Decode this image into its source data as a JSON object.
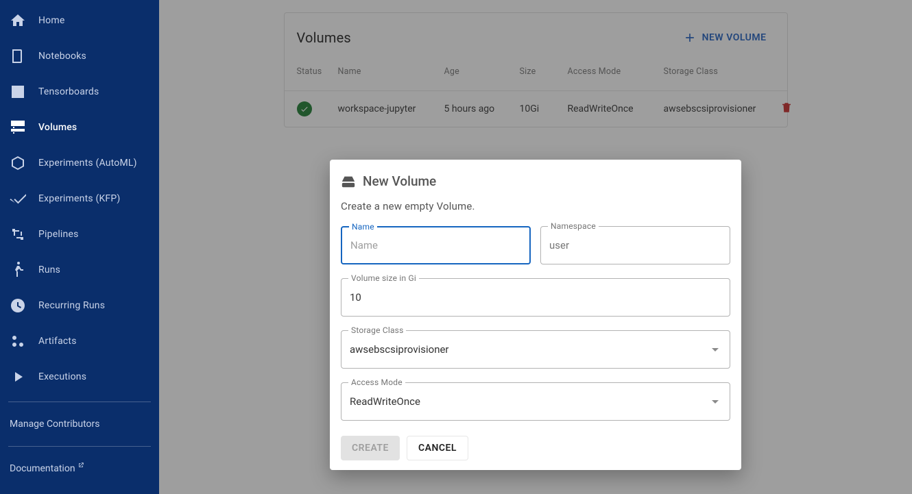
{
  "sidebar": {
    "items": [
      {
        "label": "Home"
      },
      {
        "label": "Notebooks"
      },
      {
        "label": "Tensorboards"
      },
      {
        "label": "Volumes"
      },
      {
        "label": "Experiments (AutoML)"
      },
      {
        "label": "Experiments (KFP)"
      },
      {
        "label": "Pipelines"
      },
      {
        "label": "Runs"
      },
      {
        "label": "Recurring Runs"
      },
      {
        "label": "Artifacts"
      },
      {
        "label": "Executions"
      }
    ],
    "manage": "Manage Contributors",
    "documentation": "Documentation"
  },
  "card": {
    "title": "Volumes",
    "new_btn": "NEW VOLUME",
    "columns": {
      "status": "Status",
      "name": "Name",
      "age": "Age",
      "size": "Size",
      "access": "Access Mode",
      "storage": "Storage Class"
    },
    "row": {
      "name": "workspace-jupyter",
      "age": "5 hours ago",
      "size": "10Gi",
      "access": "ReadWriteOnce",
      "storage": "awsebscsiprovisioner"
    }
  },
  "dialog": {
    "title": "New Volume",
    "sub": "Create a new empty Volume.",
    "name": {
      "label": "Name",
      "placeholder": "Name",
      "value": ""
    },
    "namespace": {
      "label": "Namespace",
      "value": "user"
    },
    "size": {
      "label": "Volume size in Gi",
      "value": "10"
    },
    "storage": {
      "label": "Storage Class",
      "value": "awsebscsiprovisioner"
    },
    "access": {
      "label": "Access Mode",
      "value": "ReadWriteOnce"
    },
    "create": "CREATE",
    "cancel": "CANCEL"
  }
}
